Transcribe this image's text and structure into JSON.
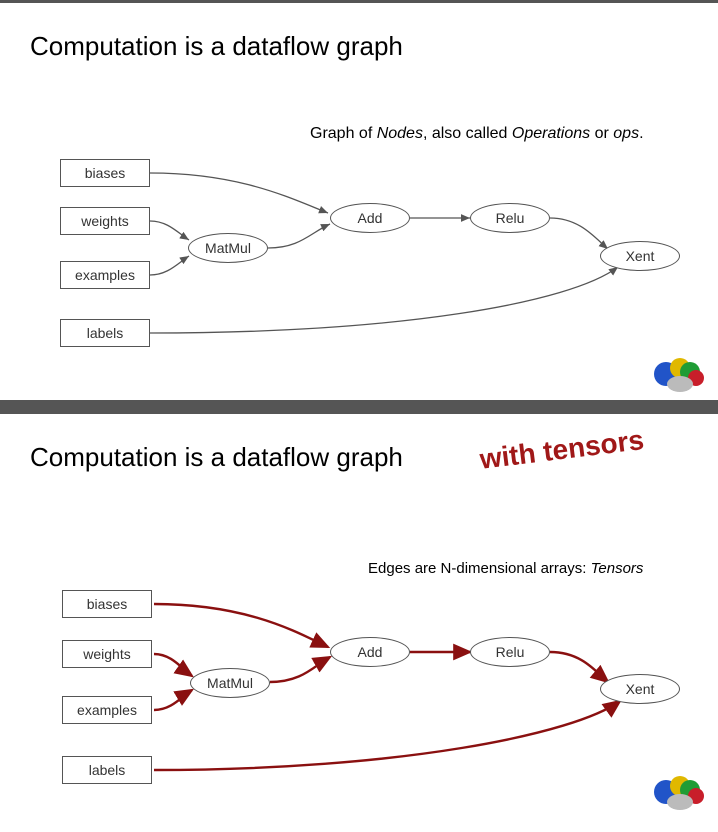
{
  "slide1": {
    "title": "Computation is a dataflow graph",
    "caption_prefix": "Graph of ",
    "caption_nodes": "Nodes",
    "caption_mid": ", also called ",
    "caption_ops": "Operations",
    "caption_or": " or ",
    "caption_ops2": "ops",
    "caption_period": ".",
    "boxes": {
      "biases": "biases",
      "weights": "weights",
      "examples": "examples",
      "labels": "labels"
    },
    "nodes": {
      "matmul": "MatMul",
      "add": "Add",
      "relu": "Relu",
      "xent": "Xent"
    },
    "edge_color": "#555555"
  },
  "slide2": {
    "title": "Computation is a dataflow graph",
    "tagline": "with tensors",
    "caption_prefix": "Edges are N-dimensional arrays: ",
    "caption_tensors": "Tensors",
    "boxes": {
      "biases": "biases",
      "weights": "weights",
      "examples": "examples",
      "labels": "labels"
    },
    "nodes": {
      "matmul": "MatMul",
      "add": "Add",
      "relu": "Relu",
      "xent": "Xent"
    },
    "edge_color": "#8a1010"
  }
}
